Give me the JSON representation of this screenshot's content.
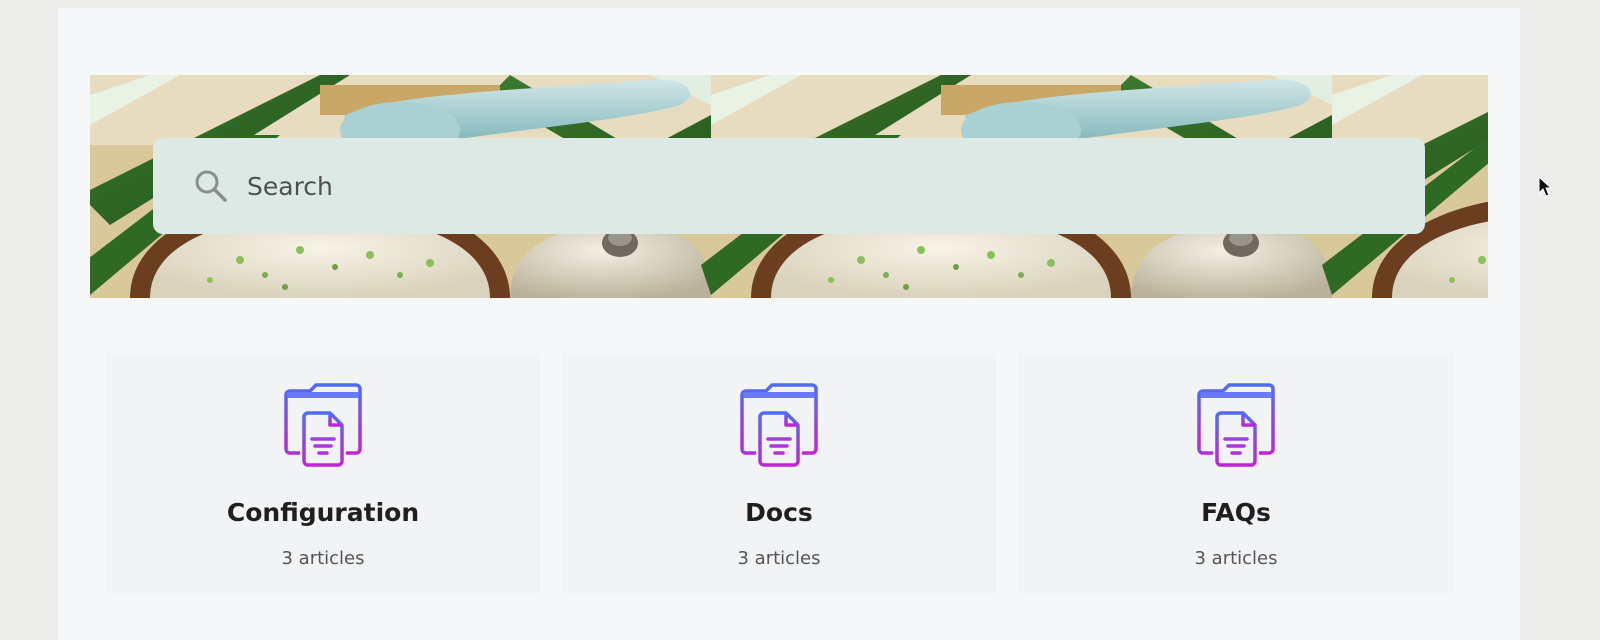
{
  "search": {
    "placeholder": "Search",
    "icon": "search-icon"
  },
  "hero": {
    "image": "tea-and-soup-banner"
  },
  "categories": [
    {
      "title": "Configuration",
      "count": "3 articles",
      "icon": "folder-document-icon"
    },
    {
      "title": "Docs",
      "count": "3 articles",
      "icon": "folder-document-icon"
    },
    {
      "title": "FAQs",
      "count": "3 articles",
      "icon": "folder-document-icon"
    }
  ],
  "colors": {
    "search_bg": "#dce9e4",
    "icon_gradient_start": "#4f6cf7",
    "icon_gradient_end": "#c026d3",
    "card_bg": "#f2f3f4",
    "page_bg": "#f6f7f9"
  }
}
